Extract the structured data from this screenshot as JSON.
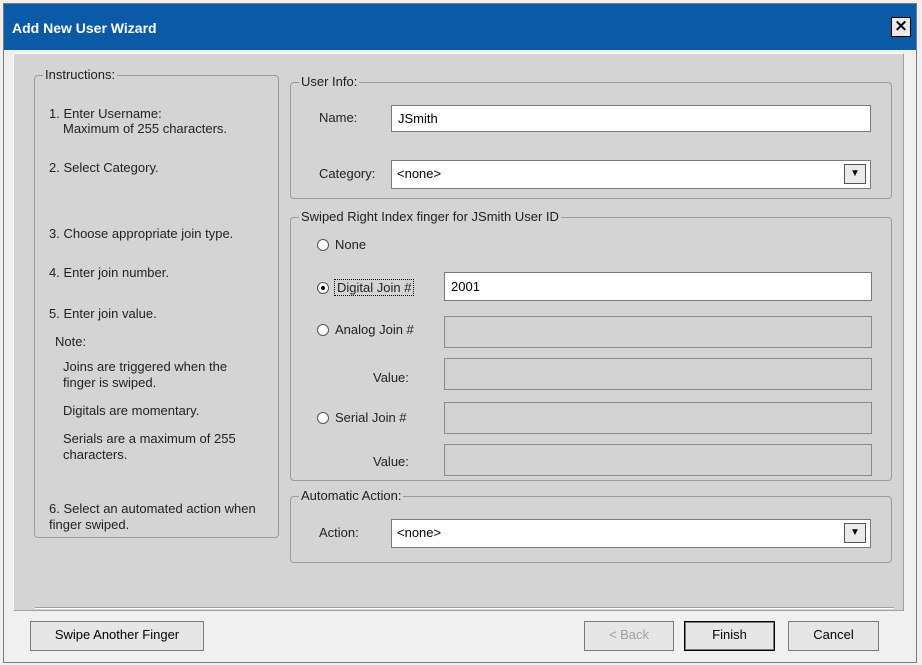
{
  "window": {
    "title": "Add New User Wizard",
    "close_glyph": "×"
  },
  "instructions": {
    "title": "Instructions:",
    "step1": "1. Enter Username:",
    "step1_note": "Maximum of 255 characters.",
    "step2": "2. Select Category.",
    "step3": "3. Choose appropriate join type.",
    "step4": "4. Enter join number.",
    "step5": "5. Enter join value.",
    "note_title": "Note:",
    "note1": "Joins are triggered when the finger is swiped.",
    "note2": "Digitals are momentary.",
    "note3": "Serials are a maximum of 255 characters.",
    "step6": "6. Select an automated action when finger swiped."
  },
  "user_info": {
    "title": "User Info:",
    "name_label": "Name:",
    "name_value": "JSmith",
    "category_label": "Category:",
    "category_value": "<none>"
  },
  "swipe": {
    "title": "Swiped Right Index finger for JSmith User ID",
    "none_label": "None",
    "digital_label": "Digital Join #",
    "digital_value": "2001",
    "analog_label": "Analog Join #",
    "analog_value_label": "Value:",
    "serial_label": "Serial Join #",
    "serial_value_label": "Value:",
    "selected": "digital"
  },
  "auto_action": {
    "title": "Automatic Action:",
    "action_label": "Action:",
    "action_value": "<none>"
  },
  "buttons": {
    "swipe_another": "Swipe Another Finger",
    "back": "< Back",
    "finish": "Finish",
    "cancel": "Cancel"
  },
  "icons": {
    "dropdown": "chevron-down-icon",
    "close": "close-icon"
  },
  "colors": {
    "titlebar": "#0b5aa8",
    "panel": "#d4d4d4"
  }
}
